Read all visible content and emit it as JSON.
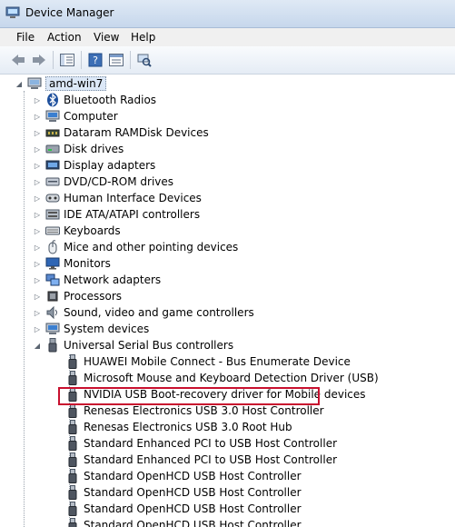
{
  "window": {
    "title": "Device Manager"
  },
  "menu": [
    "File",
    "Action",
    "View",
    "Help"
  ],
  "toolbar": {
    "buttons": [
      "back-arrow-icon",
      "forward-arrow-icon",
      "show-hide-tree-icon",
      "help-icon",
      "properties-icon",
      "scan-hardware-icon"
    ]
  },
  "tree": {
    "root": "amd-win7",
    "categories": [
      {
        "label": "Bluetooth Radios",
        "icon": "bluetooth-icon"
      },
      {
        "label": "Computer",
        "icon": "computer-icon"
      },
      {
        "label": "Dataram RAMDisk Devices",
        "icon": "ramdisk-icon"
      },
      {
        "label": "Disk drives",
        "icon": "disk-drive-icon"
      },
      {
        "label": "Display adapters",
        "icon": "display-adapter-icon"
      },
      {
        "label": "DVD/CD-ROM drives",
        "icon": "dvd-drive-icon"
      },
      {
        "label": "Human Interface Devices",
        "icon": "hid-icon"
      },
      {
        "label": "IDE ATA/ATAPI controllers",
        "icon": "ide-controller-icon"
      },
      {
        "label": "Keyboards",
        "icon": "keyboard-icon"
      },
      {
        "label": "Mice and other pointing devices",
        "icon": "mouse-icon"
      },
      {
        "label": "Monitors",
        "icon": "monitor-icon"
      },
      {
        "label": "Network adapters",
        "icon": "network-adapter-icon"
      },
      {
        "label": "Processors",
        "icon": "processor-icon"
      },
      {
        "label": "Sound, video and game controllers",
        "icon": "sound-icon"
      },
      {
        "label": "System devices",
        "icon": "system-devices-icon"
      },
      {
        "label": "Universal Serial Bus controllers",
        "icon": "usb-controller-icon"
      }
    ],
    "usb_children": [
      "HUAWEI Mobile Connect - Bus Enumerate Device",
      "Microsoft Mouse and Keyboard Detection Driver (USB)",
      "NVIDIA USB Boot-recovery driver for Mobile devices",
      "Renesas Electronics USB 3.0 Host Controller",
      "Renesas Electronics USB 3.0 Root Hub",
      "Standard Enhanced PCI to USB Host Controller",
      "Standard Enhanced PCI to USB Host Controller",
      "Standard OpenHCD USB Host Controller",
      "Standard OpenHCD USB Host Controller",
      "Standard OpenHCD USB Host Controller",
      "Standard OpenHCD USB Host Controller"
    ],
    "highlighted_child_index": 2,
    "highlight_color": "#c8102e"
  }
}
